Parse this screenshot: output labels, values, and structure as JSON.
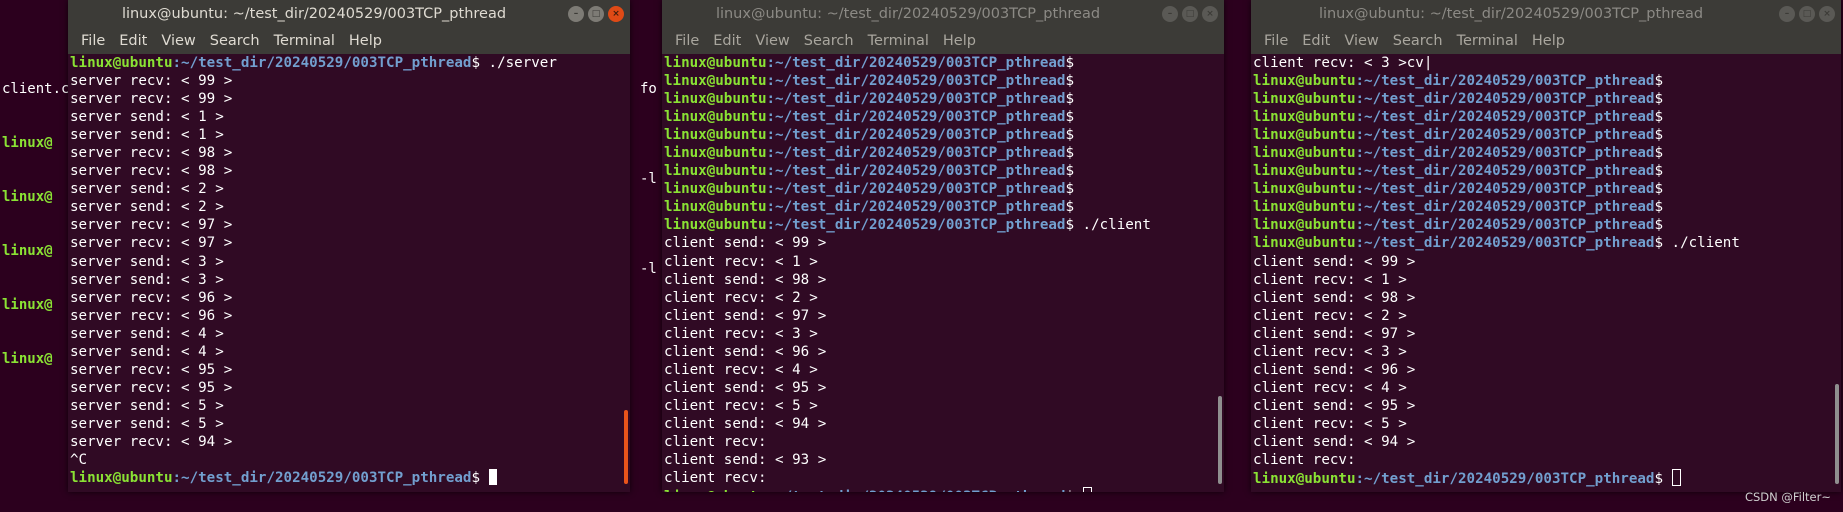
{
  "prompt": {
    "user": "linux@ubuntu",
    "path": ":~/test_dir/20240529/003TCP_pthread",
    "symbol": "$"
  },
  "menu": [
    "File",
    "Edit",
    "View",
    "Search",
    "Terminal",
    "Help"
  ],
  "background": {
    "left_lines": [
      "client.c",
      "linux@",
      "linux@",
      "linux@",
      "linux@",
      "linux@"
    ],
    "middle_lines": [
      "fo",
      "",
      "-l",
      "",
      "-l"
    ]
  },
  "windows": [
    {
      "title": "linux@ubuntu: ~/test_dir/20240529/003TCP_pthread",
      "lines": [
        {
          "prompt": true,
          "cmd": " ./server"
        },
        {
          "text": "server recv: < 99 >"
        },
        {
          "text": "server recv: < 99 >"
        },
        {
          "text": "server send: < 1 >"
        },
        {
          "text": "server send: < 1 >"
        },
        {
          "text": "server recv: < 98 >"
        },
        {
          "text": "server recv: < 98 >"
        },
        {
          "text": "server send: < 2 >"
        },
        {
          "text": "server send: < 2 >"
        },
        {
          "text": "server recv: < 97 >"
        },
        {
          "text": "server recv: < 97 >"
        },
        {
          "text": "server send: < 3 >"
        },
        {
          "text": "server send: < 3 >"
        },
        {
          "text": "server recv: < 96 >"
        },
        {
          "text": "server recv: < 96 >"
        },
        {
          "text": "server send: < 4 >"
        },
        {
          "text": "server send: < 4 >"
        },
        {
          "text": "server recv: < 95 >"
        },
        {
          "text": "server recv: < 95 >"
        },
        {
          "text": "server send: < 5 >"
        },
        {
          "text": "server send: < 5 >"
        },
        {
          "text": "server recv: < 94 >"
        },
        {
          "text": "^C"
        },
        {
          "prompt": true,
          "cmd": " ",
          "cursor": "block"
        }
      ]
    },
    {
      "title": "linux@ubuntu: ~/test_dir/20240529/003TCP_pthread",
      "lines": [
        {
          "prompt": true,
          "cmd": ""
        },
        {
          "prompt": true,
          "cmd": ""
        },
        {
          "prompt": true,
          "cmd": ""
        },
        {
          "prompt": true,
          "cmd": ""
        },
        {
          "prompt": true,
          "cmd": ""
        },
        {
          "prompt": true,
          "cmd": ""
        },
        {
          "prompt": true,
          "cmd": ""
        },
        {
          "prompt": true,
          "cmd": ""
        },
        {
          "prompt": true,
          "cmd": ""
        },
        {
          "prompt": true,
          "cmd": " ./client"
        },
        {
          "text": "client send: < 99 >"
        },
        {
          "text": "client recv: < 1 >"
        },
        {
          "text": "client send: < 98 >"
        },
        {
          "text": "client recv: < 2 >"
        },
        {
          "text": "client send: < 97 >"
        },
        {
          "text": "client recv: < 3 >"
        },
        {
          "text": "client send: < 96 >"
        },
        {
          "text": "client recv: < 4 >"
        },
        {
          "text": "client send: < 95 >"
        },
        {
          "text": "client recv: < 5 >"
        },
        {
          "text": "client send: < 94 >"
        },
        {
          "text": "client recv:"
        },
        {
          "text": "client send: < 93 >"
        },
        {
          "text": "client recv:"
        },
        {
          "prompt": true,
          "cmd": " ",
          "cursor": "hollow"
        }
      ]
    },
    {
      "title": "linux@ubuntu: ~/test_dir/20240529/003TCP_pthread",
      "lines": [
        {
          "text": "client recv: < 3 >cv|"
        },
        {
          "prompt": true,
          "cmd": ""
        },
        {
          "prompt": true,
          "cmd": ""
        },
        {
          "prompt": true,
          "cmd": ""
        },
        {
          "prompt": true,
          "cmd": ""
        },
        {
          "prompt": true,
          "cmd": ""
        },
        {
          "prompt": true,
          "cmd": ""
        },
        {
          "prompt": true,
          "cmd": ""
        },
        {
          "prompt": true,
          "cmd": ""
        },
        {
          "prompt": true,
          "cmd": ""
        },
        {
          "prompt": true,
          "cmd": " ./client"
        },
        {
          "text": "client send: < 99 >"
        },
        {
          "text": "client recv: < 1 >"
        },
        {
          "text": "client send: < 98 >"
        },
        {
          "text": "client recv: < 2 >"
        },
        {
          "text": "client send: < 97 >"
        },
        {
          "text": "client recv: < 3 >"
        },
        {
          "text": "client send: < 96 >"
        },
        {
          "text": "client recv: < 4 >"
        },
        {
          "text": "client send: < 95 >"
        },
        {
          "text": "client recv: < 5 >"
        },
        {
          "text": "client send: < 94 >"
        },
        {
          "text": "client recv:"
        },
        {
          "prompt": true,
          "cmd": " ",
          "cursor": "hollow"
        }
      ]
    }
  ],
  "watermark": "CSDN @Filter~",
  "colors": {
    "terminal_bg": "#300a24",
    "desktop_bg": "#2c001e",
    "prompt_user": "#8ae234",
    "prompt_path": "#729fcf",
    "close_button": "#df4a16",
    "scrollbar_active": "#e9541b",
    "scrollbar_inactive": "#8f8f8f"
  }
}
